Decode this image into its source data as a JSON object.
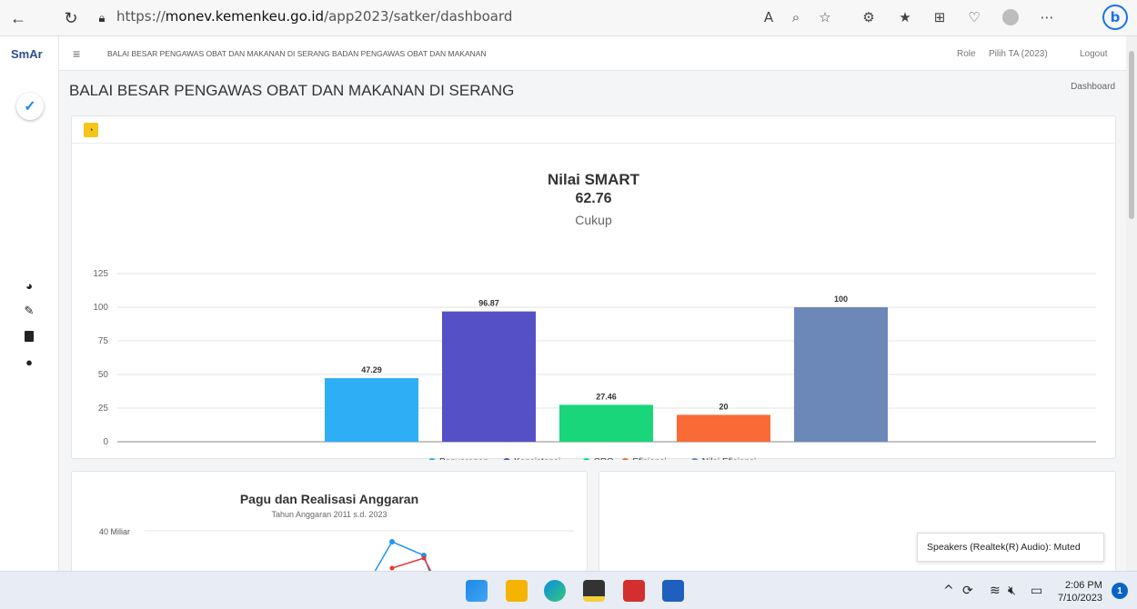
{
  "browser": {
    "url_prefix": "https://",
    "url_host": "monev.kemenkeu.go.id",
    "url_path": "/app2023/satker/dashboard"
  },
  "app": {
    "logo_text": "SmAr",
    "header_title": "BALAI BESAR PENGAWAS OBAT DAN MAKANAN DI SERANG BADAN PENGAWAS OBAT DAN MAKANAN",
    "header_links": [
      "Role",
      "Pilih TA (2023)",
      "Logout"
    ],
    "page_title": "BALAI BESAR PENGAWAS OBAT DAN MAKANAN DI SERANG",
    "breadcrumb": "Dashboard"
  },
  "sidebar": {
    "icons": [
      "dashboard-icon",
      "edit-icon",
      "book-icon",
      "user-icon"
    ]
  },
  "chart_data": [
    {
      "type": "bar",
      "title": "Nilai SMART",
      "subtitle_value": "62.76",
      "subtitle_label": "Cukup",
      "categories": [
        "Penyerapan",
        "Konsistensi",
        "CRO",
        "Efisiensi",
        "Nilai Efisiensi"
      ],
      "values": [
        47.29,
        96.87,
        27.46,
        20,
        100
      ],
      "value_labels": [
        "47.29",
        "96.87",
        "27.46",
        "20",
        "100"
      ],
      "colors": [
        "#2eaef5",
        "#5650c7",
        "#19d67a",
        "#fa6a36",
        "#6c88b9"
      ],
      "yticks": [
        0,
        25,
        50,
        75,
        100,
        125
      ],
      "ylim": [
        0,
        125
      ],
      "legend": "bottom",
      "grid": true
    },
    {
      "type": "line",
      "title": "Pagu dan Realisasi Anggaran",
      "subtitle": "Tahun Anggaran 2011 s.d. 2023",
      "ytick_visible": "40 Miliar"
    }
  ],
  "notification": {
    "toast": "Speakers (Realtek(R) Audio): Muted"
  },
  "taskbar": {
    "time": "2:06 PM",
    "date": "7/10/2023",
    "badge": "1"
  }
}
